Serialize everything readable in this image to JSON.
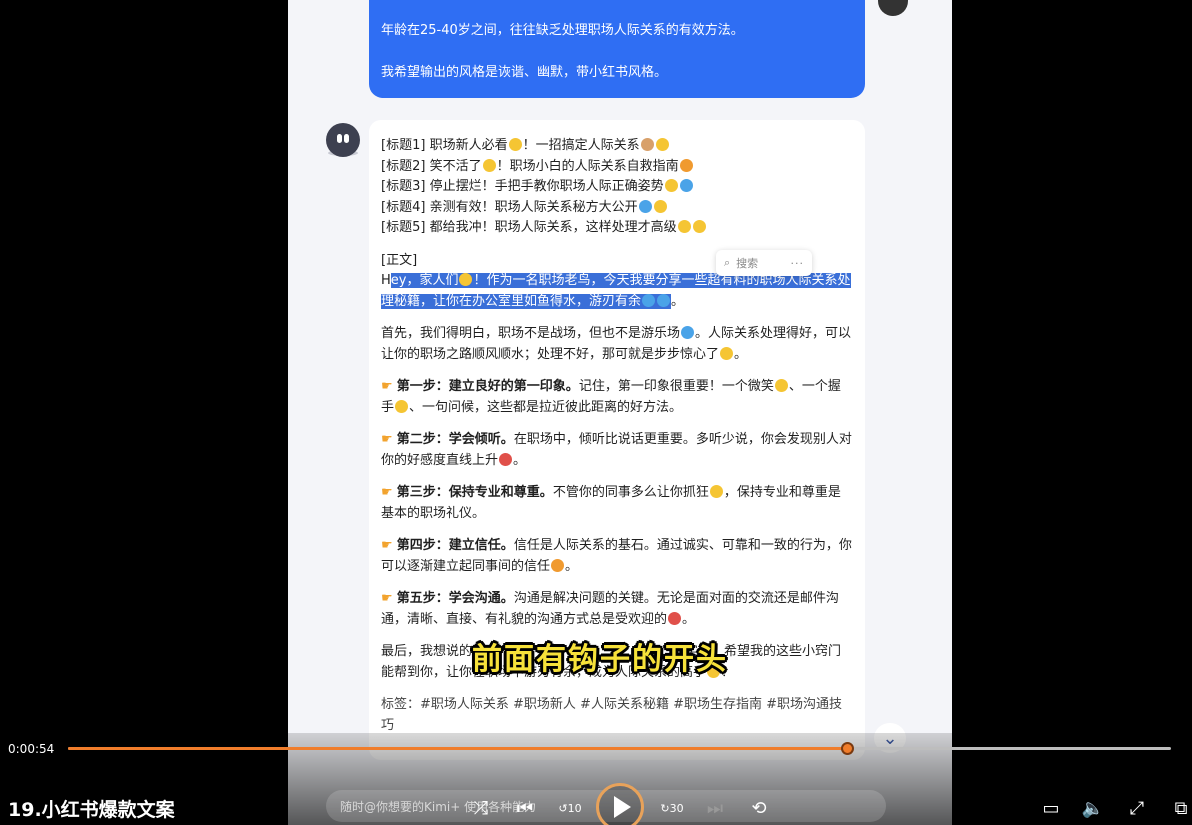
{
  "chat": {
    "user_message": {
      "line1": "年龄在25-40岁之间，往往缺乏处理职场人际关系的有效方法。",
      "line2": "我希望输出的风格是诙谐、幽默，带小红书风格。"
    },
    "titles": [
      {
        "label": "[标题1]",
        "text": "职场新人必看",
        "text2": "！一招搞定人际关系"
      },
      {
        "label": "[标题2]",
        "text": "笑不活了",
        "text2": "！职场小白的人际关系自救指南"
      },
      {
        "label": "[标题3]",
        "text": "停止摆烂！手把手教你职场人际正确姿势",
        "text2": ""
      },
      {
        "label": "[标题4]",
        "text": "亲测有效！职场人际关系秘方大公开",
        "text2": ""
      },
      {
        "label": "[标题5]",
        "text": "都给我冲！职场人际关系，这样处理才高级",
        "text2": ""
      }
    ],
    "body_label": "[正文]",
    "intro": {
      "lead": "H",
      "highlight1": "ey，家人们",
      "highlight2": "！作为一名职场老鸟，今天我要分享一些超有料的职场人际关系处理秘籍，让你在办公室里如鱼得水，游刃有余",
      "tail": "。"
    },
    "para1": {
      "a": "首先，我们得明白，职场不是战场，但也不是游乐场",
      "b": "。人际关系处理得好，可以让你的职场之路顺风顺水；处理不好，那可就是步步惊心了",
      "c": "。"
    },
    "steps": [
      {
        "title": "第一步：建立良好的第一印象。",
        "a": "记住，第一印象很重要！一个微笑",
        "b": "、一个握手",
        "c": "、一句问候，这些都是拉近彼此距离的好方法。"
      },
      {
        "title": "第二步：学会倾听。",
        "a": "在职场中，倾听比说话更重要。多听少说，你会发现别人对你的好感度直线上升",
        "b": "。",
        "c": ""
      },
      {
        "title": "第三步：保持专业和尊重。",
        "a": "不管你的同事多么让你抓狂",
        "b": "，保持专业和尊重是基本的职场礼仪。",
        "c": ""
      },
      {
        "title": "第四步：建立信任。",
        "a": "信任是人际关系的基石。通过诚实、可靠和一致的行为，你可以逐渐建立起同事间的信任",
        "b": "。",
        "c": ""
      },
      {
        "title": "第五步：学会沟通。",
        "a": "沟通是解决问题的关键。无论是面对面的交流还是邮件沟通，清晰、直接、有礼貌的沟通方式总是受欢迎的",
        "b": "。",
        "c": ""
      }
    ],
    "final": {
      "a": "最后，我想说的",
      "b": "和实践。希望我的这些小窍门能帮到你，让你在职场中游刃有余，成为人际关系的高手",
      "c": "！"
    },
    "tags": "标签：#职场人际关系 #职场新人 #人际关系秘籍 #职场生存指南 #职场沟通技巧",
    "search_popup": {
      "label": "搜索",
      "more": "···"
    },
    "input_placeholder": "随时@你想要的Kimi+ 使用各种能力"
  },
  "caption": "前面有钩子的开头",
  "player": {
    "time": "0:00:54",
    "progress": 0.706,
    "video_title": "19.小红书爆款文案"
  },
  "colors": {
    "accent": "#f07d2b",
    "user_bubble": "#2f6ef3",
    "highlight": "#3a6fd8",
    "caption": "#f6e13a"
  }
}
